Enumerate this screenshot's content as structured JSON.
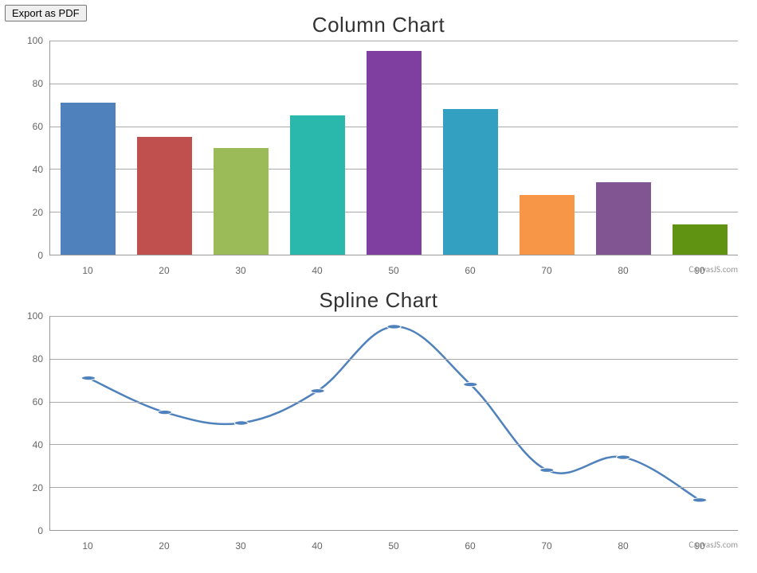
{
  "export_button_label": "Export as PDF",
  "attribution": "CanvasJS.com",
  "chart_data": [
    {
      "type": "bar",
      "title": "Column Chart",
      "categories": [
        10,
        20,
        30,
        40,
        50,
        60,
        70,
        80,
        90
      ],
      "values": [
        71,
        55,
        50,
        65,
        95,
        68,
        28,
        34,
        14
      ],
      "colors": [
        "#4f81bc",
        "#c0504e",
        "#9bbb58",
        "#2ab8ac",
        "#7f3fa0",
        "#33a0c1",
        "#f79646",
        "#815591",
        "#5f9311"
      ],
      "xlabel": "",
      "ylabel": "",
      "ylim": [
        0,
        100
      ],
      "yticks": [
        0,
        20,
        40,
        60,
        80,
        100
      ]
    },
    {
      "type": "line",
      "title": "Spline Chart",
      "x": [
        10,
        20,
        30,
        40,
        50,
        60,
        70,
        80,
        90
      ],
      "values": [
        71,
        55,
        50,
        65,
        95,
        68,
        28,
        34,
        14
      ],
      "line_color": "#4f81bc",
      "xlabel": "",
      "ylabel": "",
      "ylim": [
        0,
        100
      ],
      "yticks": [
        0,
        20,
        40,
        60,
        80,
        100
      ]
    }
  ]
}
